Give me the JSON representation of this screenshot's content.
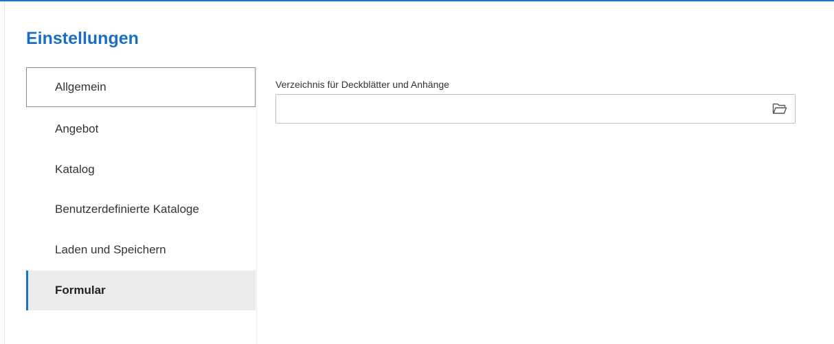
{
  "header": {
    "title": "Einstellungen"
  },
  "sidebar": {
    "items": [
      {
        "label": "Allgemein",
        "state": "focused"
      },
      {
        "label": "Angebot",
        "state": "normal"
      },
      {
        "label": "Katalog",
        "state": "normal"
      },
      {
        "label": "Benutzerdefinierte Kataloge",
        "state": "normal"
      },
      {
        "label": "Laden und Speichern",
        "state": "normal"
      },
      {
        "label": "Formular",
        "state": "selected"
      }
    ]
  },
  "main": {
    "directory_field": {
      "label": "Verzeichnis für Deckblätter und Anhänge",
      "value": "",
      "placeholder": "",
      "icon": "folder-open-icon"
    }
  },
  "colors": {
    "accent": "#1a73c8",
    "title": "#1a6fc0",
    "selected_bg": "#ececec"
  }
}
